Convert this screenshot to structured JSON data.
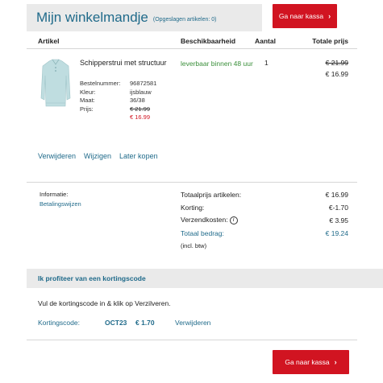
{
  "header": {
    "title": "Mijn winkelmandje",
    "saved_label": "(Opgeslagen artikelen: 0)"
  },
  "checkout_button": {
    "label": "Ga naar kassa",
    "icon": "chevron-right"
  },
  "columns": {
    "article": "Artikel",
    "availability": "Beschikbaarheid",
    "quantity": "Aantal",
    "total": "Totale prijs"
  },
  "item": {
    "name": "Schipperstrui met structuur",
    "order_number_label": "Bestelnummer:",
    "order_number": "96872581",
    "color_label": "Kleur:",
    "color": "ijsblauw",
    "size_label": "Maat:",
    "size": "36/38",
    "price_label": "Prijs:",
    "old_price": "€ 21.99",
    "new_price": "€ 16.99",
    "availability": "leverbaar binnen 48 uur",
    "quantity": "1",
    "total_old": "€ 21.99",
    "total_new": "€ 16.99"
  },
  "actions": {
    "remove": "Verwijderen",
    "edit": "Wijzigen",
    "later": "Later kopen"
  },
  "info": {
    "label": "Informatie:",
    "payment_link": "Betalingswijzen"
  },
  "summary": {
    "items_label": "Totaalprijs artikelen:",
    "items_value": "€ 16.99",
    "discount_label": "Korting:",
    "discount_value": "€-1.70",
    "shipping_label": "Verzendkosten:",
    "shipping_value": "€ 3.95",
    "total_label": "Totaal bedrag:",
    "total_value": "€ 19.24",
    "vat_note": "(incl. btw)"
  },
  "discount": {
    "heading": "Ik profiteer van een kortingscode",
    "instruction": "Vul de kortingscode in & klik op Verzilveren.",
    "code_label": "Kortingscode:",
    "code": "OCT23",
    "amount": "€ 1.70",
    "remove": "Verwijderen"
  },
  "colors": {
    "accent_blue": "#1f6a8a",
    "button_red": "#d11421",
    "availability_green": "#3a8f3a"
  }
}
